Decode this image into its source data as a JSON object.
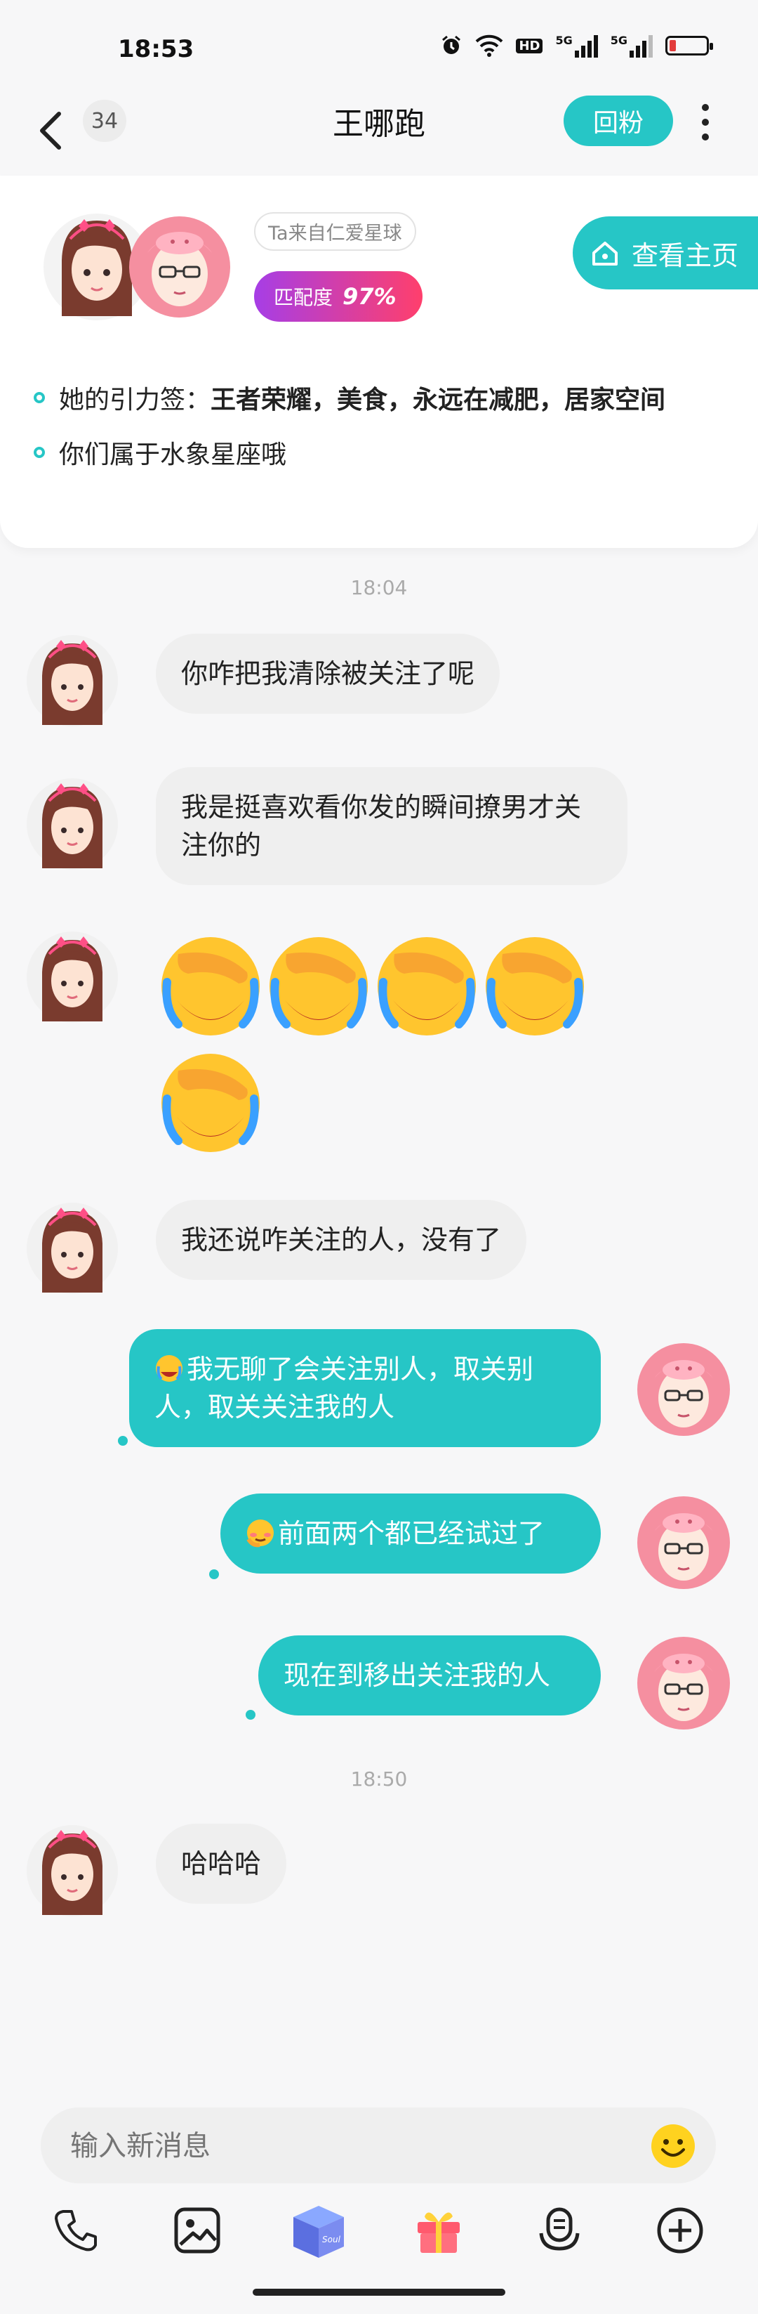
{
  "status_bar": {
    "time": "18:53",
    "net_labels": [
      "HD",
      "5G",
      "5G"
    ]
  },
  "nav": {
    "back_icon": "chevron-left-icon",
    "unread_count": "34",
    "title": "王哪跑",
    "follow_back_label": "回粉",
    "more_icon": "more-vertical-icon"
  },
  "profile": {
    "origin": "Ta来自仁爱星球",
    "match_label": "匹配度",
    "match_value": "97%",
    "homepage_label": "查看主页",
    "gravity_prefix": "她的引力签：",
    "gravity_tags": "王者荣耀，美食，永远在减肥，居家空间",
    "zodiac_line": "你们属于水象星座哦"
  },
  "chat": {
    "timestamps": [
      "18:04",
      "18:50"
    ],
    "messages": [
      {
        "side": "in",
        "text": "你咋把我清除被关注了呢"
      },
      {
        "side": "in",
        "text": "我是挺喜欢看你发的瞬间撩男才关注你的"
      },
      {
        "side": "in",
        "type": "emoji",
        "emoji": "face-palm-crying-emoji",
        "count": 5
      },
      {
        "side": "in",
        "text": "我还说咋关注的人，没有了"
      },
      {
        "side": "out",
        "text": "我无聊了会关注别人，取关别人，取关关注我的人",
        "leading_emoji": "crying-emoji"
      },
      {
        "side": "out",
        "text": "前面两个都已经试过了",
        "leading_emoji": "shy-emoji"
      },
      {
        "side": "out",
        "text": "现在到移出关注我的人"
      },
      {
        "side": "in",
        "text": "哈哈哈"
      }
    ]
  },
  "composer": {
    "placeholder": "输入新消息"
  },
  "toolbar": {
    "items": [
      "phone-icon",
      "image-icon",
      "soul-box-icon",
      "gift-icon",
      "voice-icon",
      "plus-icon"
    ],
    "box_label": "Soul"
  },
  "colors": {
    "accent": "#26c6c6",
    "match_start": "#a63ee6",
    "match_end": "#ff3f6c",
    "bubble_in": "#efefef"
  }
}
